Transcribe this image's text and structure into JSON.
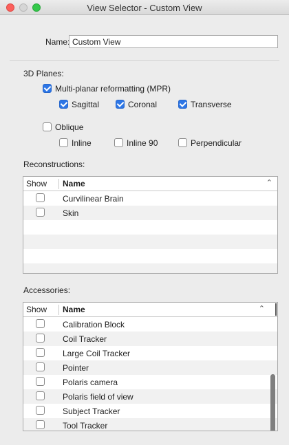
{
  "window": {
    "title": "View Selector - Custom View"
  },
  "name_field": {
    "label": "Name:",
    "value": "Custom View"
  },
  "planes": {
    "heading": "3D Planes:",
    "mpr": {
      "label": "Multi-planar reformatting (MPR)",
      "checked": true
    },
    "sagittal": {
      "label": "Sagittal",
      "checked": true
    },
    "coronal": {
      "label": "Coronal",
      "checked": true
    },
    "transverse": {
      "label": "Transverse",
      "checked": true
    },
    "oblique": {
      "label": "Oblique",
      "checked": false
    },
    "inline": {
      "label": "Inline",
      "checked": false
    },
    "inline90": {
      "label": "Inline 90",
      "checked": false
    },
    "perpendicular": {
      "label": "Perpendicular",
      "checked": false
    }
  },
  "reconstructions": {
    "heading": "Reconstructions:",
    "col_show": "Show",
    "col_name": "Name",
    "rows": [
      {
        "name": "Curvilinear Brain",
        "checked": false
      },
      {
        "name": "Skin",
        "checked": false
      }
    ]
  },
  "accessories": {
    "heading": "Accessories:",
    "col_show": "Show",
    "col_name": "Name",
    "rows": [
      {
        "name": "Calibration Block",
        "checked": false
      },
      {
        "name": "Coil Tracker",
        "checked": false
      },
      {
        "name": "Large Coil Tracker",
        "checked": false
      },
      {
        "name": "Pointer",
        "checked": false
      },
      {
        "name": "Polaris camera",
        "checked": false
      },
      {
        "name": "Polaris field of view",
        "checked": false
      },
      {
        "name": "Subject Tracker",
        "checked": false
      },
      {
        "name": "Tool Tracker",
        "checked": false
      }
    ],
    "scroll_position": 0.6
  },
  "colors": {
    "accent": "#2d76e6",
    "close": "#fc605c",
    "zoom": "#34c84a"
  },
  "icons": {
    "sort": "chevron-up-icon",
    "check": "checkmark-icon"
  }
}
